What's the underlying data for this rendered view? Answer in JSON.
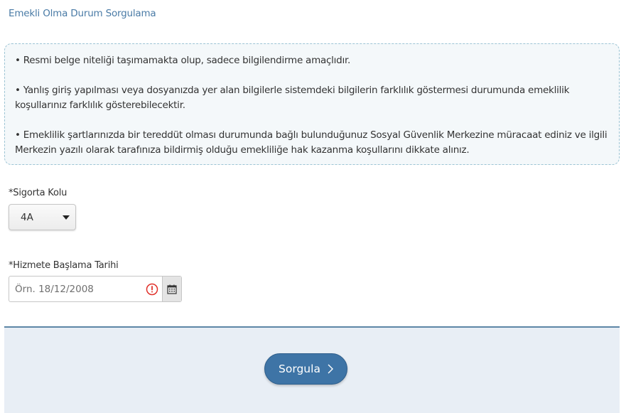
{
  "page": {
    "title": "Emekli Olma Durum Sorgulama"
  },
  "info": {
    "bullets": [
      "• Resmi belge niteliği taşımamakta olup, sadece bilgilendirme amaçlıdır.",
      "• Yanlış giriş yapılması veya dosyanızda yer alan bilgilerle sistemdeki bilgilerin farklılık göstermesi durumunda emeklilik koşullarınız farklılık gösterebilecektir.",
      "• Emeklilik şartlarınızda bir tereddüt olması durumunda bağlı bulunduğunuz Sosyal Güvenlik Merkezine müracaat ediniz ve ilgili Merkezin yazılı olarak tarafınıza bildirmiş olduğu emekliliğe hak kazanma koşullarını dikkate alınız."
    ]
  },
  "form": {
    "insurance_branch": {
      "label": "*Sigorta Kolu",
      "value": "4A"
    },
    "service_start_date": {
      "label": "*Hizmete Başlama Tarihi",
      "placeholder": "Örn. 18/12/2008",
      "value": ""
    }
  },
  "footer": {
    "submit_label": "Sorgula"
  },
  "icons": {
    "dropdown": "caret-down-icon",
    "error": "exclamation-circle-icon",
    "calendar": "calendar-icon",
    "submit": "chevron-right-icon"
  },
  "colors": {
    "title": "#4a7ba6",
    "button": "#3e74a6",
    "footer_bg": "#e8eef5",
    "error": "#e0312a"
  }
}
